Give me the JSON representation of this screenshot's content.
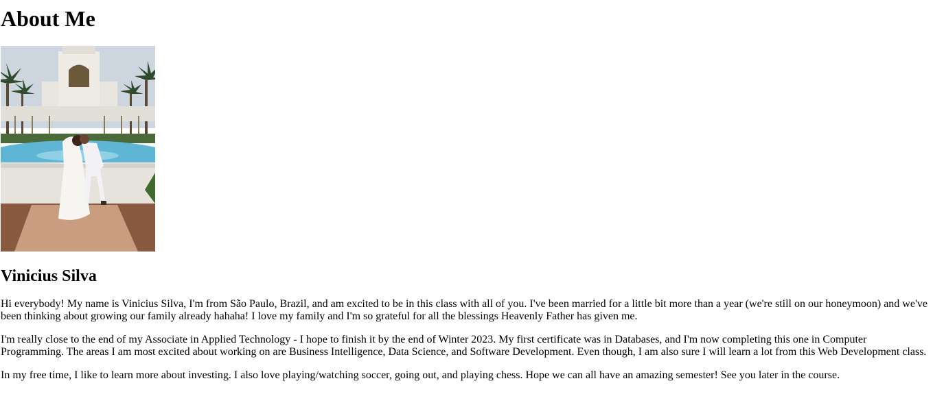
{
  "page": {
    "title": "About Me",
    "photo_alt": "Wedding photo in front of a temple fountain",
    "name": "Vinicius Silva",
    "paragraphs": [
      "Hi everybody! My name is Vinicius Silva, I'm from São Paulo, Brazil, and am excited to be in this class with all of you. I've been married for a little bit more than a year (we're still on our honeymoon) and we've been thinking about growing our family already hahaha! I love my family and I'm so grateful for all the blessings Heavenly Father has given me.",
      "I'm really close to the end of my Associate in Applied Technology - I hope to finish it by the end of Winter 2023. My first certificate was in Databases, and I'm now completing this one in Computer Programming. The areas I am most excited about working on are Business Intelligence, Data Science, and Software Development. Even though, I am also sure I will learn a lot from this Web Development class.",
      "In my free time, I like to learn more about investing. I also love playing/watching soccer, going out, and playing chess. Hope we can all have an amazing semester! See you later in the course."
    ]
  },
  "colors": {
    "text": "#000000",
    "background": "#ffffff",
    "sky": "#cfd8e2",
    "building": "#e8e6e2",
    "water": "#5fb6d4",
    "paving": "#c79a7a"
  }
}
